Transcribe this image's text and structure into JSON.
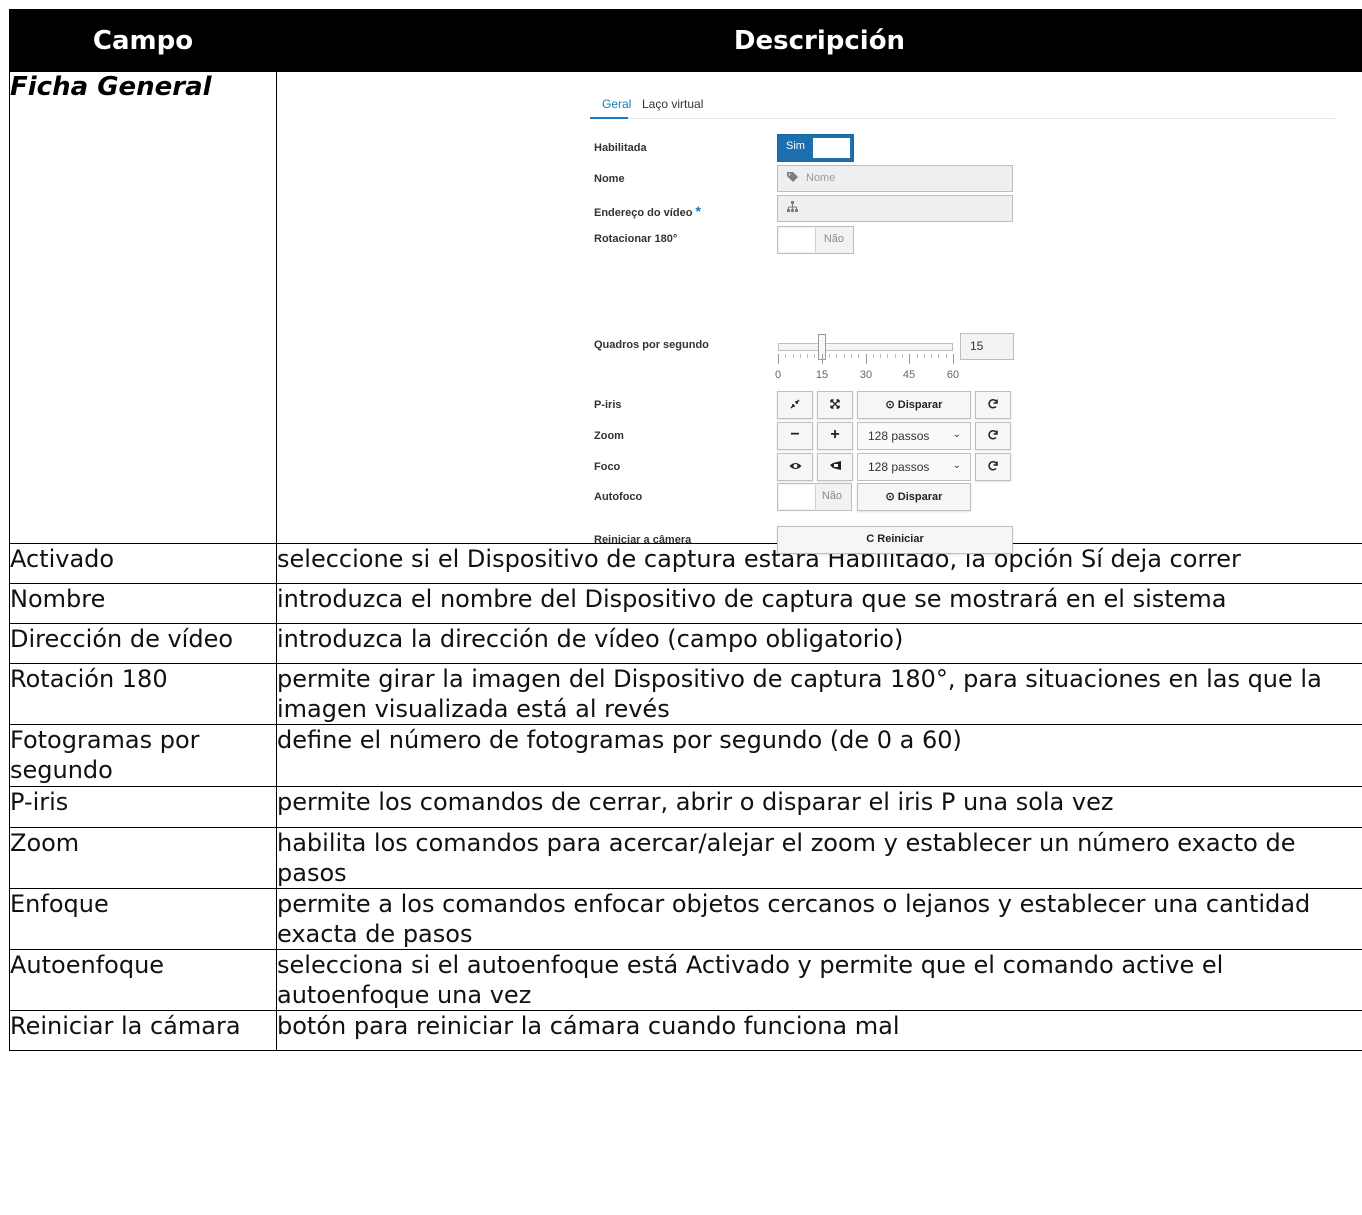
{
  "table": {
    "headers": {
      "field": "Campo",
      "description": "Descripción"
    },
    "general_tab_label": "Ficha General",
    "rows": [
      {
        "field": "Activado",
        "description": "seleccione si el Dispositivo de captura estará Habilitado, la opción Sí deja correr"
      },
      {
        "field": "Nombre",
        "description": "introduzca el nombre del Dispositivo de captura que se mostrará en el sistema"
      },
      {
        "field": "Dirección de vídeo",
        "description": "introduzca la dirección de vídeo (campo obligatorio)"
      },
      {
        "field": "Rotación 180",
        "description": "permite girar la imagen del Dispositivo de captura 180°, para situaciones en las que la imagen visualizada está al revés"
      },
      {
        "field": "Fotogramas por segundo",
        "description": "define el número de fotogramas por segundo (de 0 a 60)"
      },
      {
        "field": "P-iris",
        "description": "permite los comandos de cerrar, abrir o disparar el iris P una sola vez"
      },
      {
        "field": "Zoom",
        "description": "habilita los comandos para acercar/alejar el zoom y establecer un número exacto de pasos"
      },
      {
        "field": "Enfoque",
        "description": "permite a los comandos enfocar objetos cercanos o lejanos y establecer una cantidad exacta de pasos"
      },
      {
        "field": "Autoenfoque",
        "description": "selecciona si el autoenfoque está Activado y permite que el comando active el autoenfoque una vez"
      },
      {
        "field": "Reiniciar la cámara",
        "description": "botón para reiniciar la cámara cuando funciona mal"
      }
    ]
  },
  "form": {
    "tabs": [
      "Geral",
      "Laço virtual"
    ],
    "labels": {
      "enabled": "Habilitada",
      "name": "Nome",
      "video_address": "Endereço do vídeo",
      "required_mark": "*",
      "rotate": "Rotacionar 180°",
      "fps": "Quadros por segundo",
      "piris": "P-iris",
      "zoom": "Zoom",
      "focus": "Foco",
      "autofocus": "Autofoco",
      "restart": "Reiniciar a câmera"
    },
    "enabled_toggle": "Sim",
    "off_toggle": "Não",
    "name_placeholder": "Nome",
    "fps_value": "15",
    "fps_fraction": 0.25,
    "scale_ticks": [
      "0",
      "15",
      "30",
      "45",
      "60"
    ],
    "trigger_label": "⊙ Disparar",
    "steps_option": "128 passos",
    "restart_button": "C Reiniciar",
    "icons": {
      "tag": "tag-icon",
      "network": "sitemap-icon",
      "shrink": "compress-icon",
      "expand": "expand-icon",
      "minus": "minus-icon",
      "plus": "plus-icon",
      "eye": "eye-icon",
      "far": "binoculars-icon",
      "refresh": "refresh-icon",
      "chevron": "chevron-down-icon"
    },
    "colors": {
      "accent": "#1d6fae",
      "header": "#000000"
    }
  }
}
